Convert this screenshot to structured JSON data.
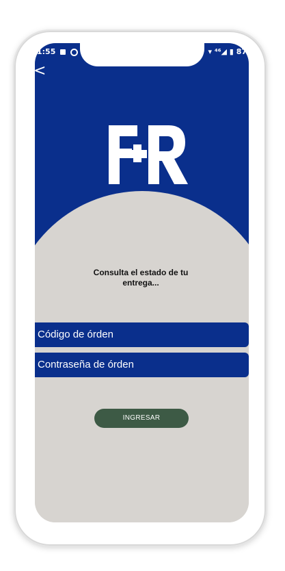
{
  "status_bar": {
    "time": "1:55",
    "right_indicators": "▾ ⁴⁶◢ ▮ 87"
  },
  "nav": {
    "back_glyph": "<"
  },
  "brand": {
    "logo_text": "FR",
    "primary_color": "#0a2f8c",
    "background_color": "#d7d4d0",
    "button_color": "#3d5a45"
  },
  "content": {
    "headline_line1": "Consulta el estado de tu",
    "headline_line2": "entrega..."
  },
  "form": {
    "order_code_placeholder": "Código de órden",
    "order_password_placeholder": "Contraseña de órden",
    "submit_label": "INGRESAR"
  }
}
